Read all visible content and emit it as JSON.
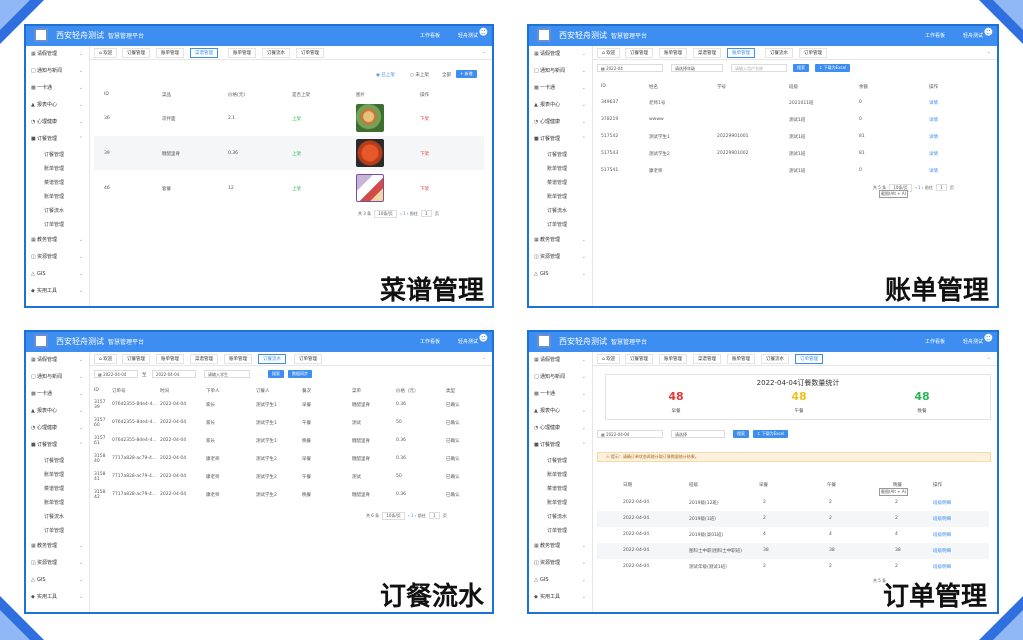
{
  "common": {
    "brand": "西安轻舟测试",
    "system": "智慧管理平台",
    "workbench": "工作看板",
    "user": "轻舟测试",
    "sidebar": [
      "请假管理",
      "通知与新闻",
      "一卡通",
      "报表中心",
      "心理健康",
      "订餐管理",
      "教务管理",
      "资源管理",
      "GIS",
      "实用工具"
    ],
    "sub_menu": [
      "订餐管理",
      "账单管理",
      "菜谱管理",
      "账单管理",
      "订餐流水",
      "订单管理"
    ],
    "tabs": [
      "欢迎",
      "订餐管理",
      "账单管理",
      "菜谱管理",
      "账单管理",
      "订餐流水",
      "订单管理"
    ]
  },
  "colors": {
    "primary": "#3d8ef0",
    "border": "#1d72d8",
    "corner": "#2f6fe0",
    "green": "#2db45a",
    "red": "#e03a3a"
  },
  "p1": {
    "caption": "菜谱管理",
    "filters": [
      "已上架",
      "未上架",
      "全部"
    ],
    "add": "+ 新增",
    "headers": [
      "ID",
      "菜品",
      "价格(元)",
      "是否上架",
      "图片",
      "操作"
    ],
    "rows": [
      {
        "id": "36",
        "name": "凉拌面",
        "price": "2.1",
        "status": "上架",
        "op": "下架"
      },
      {
        "id": "39",
        "name": "糖醋里脊",
        "price": "0.36",
        "status": "上架",
        "op": "下架"
      },
      {
        "id": "46",
        "name": "套餐",
        "price": "12",
        "status": "上架",
        "op": "下架"
      }
    ],
    "pager": {
      "total": "共 3 条",
      "size": "10条/页",
      "page": "1",
      "goto": "前往",
      "unit": "页"
    }
  },
  "p2": {
    "caption": "账单管理",
    "date": "2022-04",
    "search_ph": "请选择年级",
    "search_ph2": "请输入用户名称",
    "search": "搜索",
    "export": "下载为Excel",
    "headers": [
      "ID",
      "姓名",
      "学号",
      "班级",
      "余额",
      "操作"
    ],
    "rows": [
      {
        "id": "349637",
        "name": "老师1号",
        "sno": "",
        "cls": "2021011班",
        "bal": "0",
        "op": "详情"
      },
      {
        "id": "378219",
        "name": "wwww",
        "sno": "",
        "cls": "测试1班",
        "bal": "0",
        "op": "详情"
      },
      {
        "id": "517542",
        "name": "测试学生1",
        "sno": "20229901001",
        "cls": "测试1班",
        "bal": "81",
        "op": "详情"
      },
      {
        "id": "517543",
        "name": "测试学生2",
        "sno": "20229901002",
        "cls": "测试1班",
        "bal": "81",
        "op": "详情"
      },
      {
        "id": "517541",
        "name": "康老师",
        "sno": "",
        "cls": "测试1班",
        "bal": "0",
        "op": "详情"
      }
    ],
    "pager": {
      "total": "共 5 条",
      "size": "10条/页",
      "page": "1",
      "goto": "前往",
      "unit": "页",
      "tip": "截图(Alt + A)"
    }
  },
  "p3": {
    "caption": "订餐流水",
    "date_from": "2022-04-04",
    "to": "至",
    "date_to": "2022-04-04",
    "search_ph": "请输入学生",
    "search": "搜索",
    "sync": "数据同步",
    "headers": [
      "ID",
      "订单号",
      "时间",
      "下单人",
      "订餐人",
      "餐次",
      "菜单",
      "价格（元）",
      "类型"
    ],
    "rows": [
      {
        "id": "315739",
        "no": "076d2355-8de4-4...",
        "time": "2022-04-04",
        "buyer": "家长",
        "eater": "测试学生1",
        "meal": "早餐",
        "menu": "糖醋里脊",
        "price": "0.36",
        "type": "已确认"
      },
      {
        "id": "315760",
        "no": "076d2355-8de4-4...",
        "time": "2022-04-04",
        "buyer": "家长",
        "eater": "测试学生1",
        "meal": "午餐",
        "menu": "测试",
        "price": "50",
        "type": "已确认"
      },
      {
        "id": "315761",
        "no": "076d2355-8de4-4...",
        "time": "2022-04-04",
        "buyer": "家长",
        "eater": "测试学生1",
        "meal": "晚餐",
        "menu": "糖醋里脊",
        "price": "0.36",
        "type": "已确认"
      },
      {
        "id": "315840",
        "no": "7717a828-ac79-4...",
        "time": "2022-04-04",
        "buyer": "康老师",
        "eater": "测试学生2",
        "meal": "早餐",
        "menu": "糖醋里脊",
        "price": "0.36",
        "type": "已确认"
      },
      {
        "id": "315841",
        "no": "7717a828-ac79-4...",
        "time": "2022-04-04",
        "buyer": "康老师",
        "eater": "测试学生2",
        "meal": "午餐",
        "menu": "测试",
        "price": "50",
        "type": "已确认"
      },
      {
        "id": "315842",
        "no": "7717a828-ac79-4...",
        "time": "2022-04-04",
        "buyer": "康老师",
        "eater": "测试学生2",
        "meal": "晚餐",
        "menu": "糖醋里脊",
        "price": "0.36",
        "type": "已确认"
      }
    ],
    "pager": {
      "total": "共 6 条",
      "size": "10条/页",
      "page": "1",
      "goto": "前往",
      "unit": "页"
    }
  },
  "p4": {
    "caption": "订单管理",
    "stat_title": "2022-04-04订餐数量统计",
    "breakfast_n": "48",
    "breakfast": "早餐",
    "lunch_n": "48",
    "lunch": "午餐",
    "dinner_n": "48",
    "dinner": "晚餐",
    "date": "2022-04-04",
    "grade_ph": "请选择",
    "search": "搜索",
    "export": "下载为Excel",
    "warn": "提示：请确订单状态再统计取订餐数量统计结果。",
    "headers": [
      "日期",
      "班级",
      "早餐",
      "午餐",
      "晚餐",
      "操作"
    ],
    "tip": "截图(Alt + A)",
    "rows": [
      {
        "date": "2022-04-04",
        "cls": "2019级(12班)",
        "b": "2",
        "l": "2",
        "d": "2",
        "op": "班级明细"
      },
      {
        "date": "2022-04-04",
        "cls": "2019级(1班)",
        "b": "2",
        "l": "2",
        "d": "2",
        "op": "班级明细"
      },
      {
        "date": "2022-04-04",
        "cls": "2019级(高01班)",
        "b": "4",
        "l": "4",
        "d": "4",
        "op": "班级明细"
      },
      {
        "date": "2022-04-04",
        "cls": "图科士中职(图科士中职班)",
        "b": "38",
        "l": "38",
        "d": "38",
        "op": "班级明细"
      },
      {
        "date": "2022-04-04",
        "cls": "测试年级(测试1班)",
        "b": "2",
        "l": "2",
        "d": "2",
        "op": "班级明细"
      }
    ],
    "pager_total": "共 5 条"
  }
}
